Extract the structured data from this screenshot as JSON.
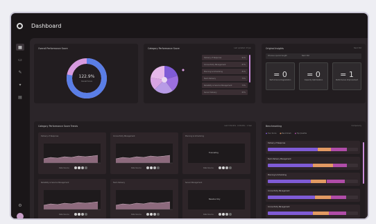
{
  "app": {
    "title": "Dashboard"
  },
  "overall": {
    "title": "Overall Performance Score",
    "value": "122.9%",
    "sub": "Overall Score",
    "fraction": 0.78
  },
  "category_score": {
    "title": "Category Performance Score",
    "meta": "Last updated: 23 Jan",
    "items": [
      {
        "label": "Delivery of Response",
        "value": "91%"
      },
      {
        "label": "Connectivity Management",
        "value": "87%"
      },
      {
        "label": "Planning & Scheduling",
        "value": "81%"
      },
      {
        "label": "Team Delivery",
        "value": "75%"
      },
      {
        "label": "Reliability & Service Management",
        "value": "73%"
      },
      {
        "label": "Server Delivery",
        "value": "65%"
      }
    ]
  },
  "insights": {
    "title": "Original Insights",
    "meta": "Next 30d",
    "filter_label": "Choose a period length",
    "filter_value": "Next 30d",
    "metrics": [
      {
        "value": "= 0",
        "label": "Performance Degradation"
      },
      {
        "value": "= 0",
        "label": "Capacity Optimization"
      },
      {
        "value": "= 1",
        "label": "Performance Improvement"
      }
    ]
  },
  "trends": {
    "title": "Category Performance Score Trends",
    "meta": "Last 3 Months · 6 Months · 1 Year",
    "panels": [
      {
        "title": "Delivery of Response",
        "status": "",
        "legend": "Data Source"
      },
      {
        "title": "Connectivity Management",
        "status": "",
        "legend": "Data Source"
      },
      {
        "title": "Planning & Scheduling",
        "status": "Forecasting",
        "legend": "Data Source"
      },
      {
        "title": "Reliability & Service Management",
        "status": "",
        "legend": "Data Source"
      },
      {
        "title": "Team Delivery",
        "status": "",
        "legend": "Data Source"
      },
      {
        "title": "Server Management",
        "status": "Baseline Only",
        "legend": "Data Source"
      }
    ]
  },
  "benchmark": {
    "title": "Benchmarking",
    "meta": "Compare by",
    "legend": [
      "Your Score",
      "Benchmark",
      "Top Quartile"
    ],
    "items": [
      {
        "label": "Delivery of Response",
        "a": 0.55,
        "b": 0.7,
        "c": 0.18
      },
      {
        "label": "Team Delivery Management",
        "a": 0.5,
        "b": 0.72,
        "c": 0.16
      },
      {
        "label": "Planning & Scheduling",
        "a": 0.48,
        "b": 0.65,
        "c": 0.2
      },
      {
        "label": "Connectivity Management",
        "a": 0.52,
        "b": 0.7,
        "c": 0.17
      },
      {
        "label": "Connectivity Management",
        "a": 0.5,
        "b": 0.68,
        "c": 0.19
      }
    ]
  },
  "colors": {
    "accent": "#c98bd9",
    "purple": "#7f5bd6",
    "orange": "#e39a63",
    "magenta": "#b04ca8"
  }
}
